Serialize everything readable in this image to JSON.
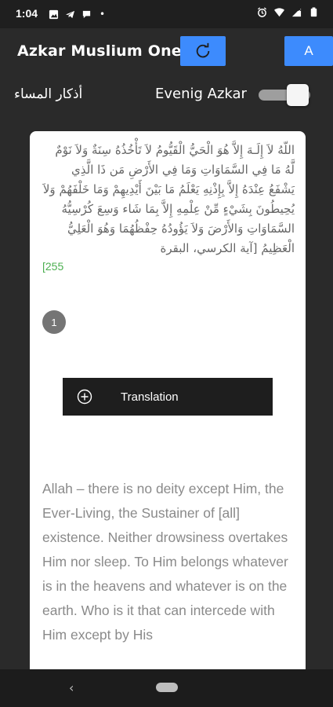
{
  "status_bar": {
    "time": "1:04",
    "dot": "•",
    "left_icons": [
      "gallery-icon",
      "telegram-icon",
      "chat-bubble-icon"
    ],
    "right_icons": [
      "alarm-icon",
      "wifi-icon",
      "no-signal-icon",
      "battery-icon"
    ]
  },
  "app_bar": {
    "title": "Azkar Muslium One",
    "refresh_icon": "refresh-icon",
    "font_button_label": "A",
    "accent_color": "#3d8bfd"
  },
  "toggle_row": {
    "arabic_title": "أذكار المساء",
    "toggle_label": "Evenig Azkar",
    "toggle_on": true
  },
  "card": {
    "arabic_verse": "اللّهُ لاَ إِلَـهَ إِلاَّ هُوَ الْحَيُّ الْقَيُّومُ لاَ تَأْخُذُهُ سِنَةٌ وَلاَ نَوْمٌ لَّهُ مَا فِي السَّمَاوَاتِ وَمَا فِي الأَرْضِ مَن ذَا الَّذِي يَشْفَعُ عِنْدَهُ إِلاَّ بِإِذْنِهِ يَعْلَمُ مَا بَيْنَ أَيْدِيهِمْ وَمَا خَلْفَهُمْ وَلاَ يُحِيطُونَ بِشَيْءٍ مِّنْ عِلْمِهِ إِلاَّ بِمَا شَاء وَسِعَ كُرْسِيُّهُ السَّمَاوَاتِ وَالأَرْضَ وَلاَ يَؤُودُهُ حِفْظُهُمَا وَهُوَ الْعَلِيُّ الْعَظِيمُ [آية الكرسي، البقرة",
    "verse_ref": "[255",
    "count": "1",
    "translation_button_label": "Translation",
    "english_text": "Allah – there is no deity except Him, the Ever-Living, the Sustainer of [all] existence. Neither drowsiness overtakes Him nor sleep. To Him belongs whatever is in the heavens and whatever is on the earth. Who is it that can intercede with Him except by His"
  },
  "nav_bar": {
    "back_glyph": "‹"
  }
}
